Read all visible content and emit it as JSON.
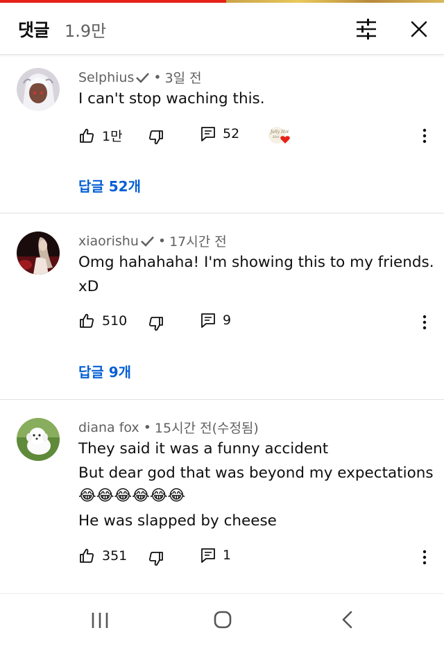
{
  "header": {
    "title": "댓글",
    "count": "1.9만",
    "filter_icon": "sliders-icon",
    "close_icon": "close-icon"
  },
  "comments": [
    {
      "author": "Selphius",
      "time": "3일 전",
      "lines": [
        "I can't stop waching this."
      ],
      "likes": "1만",
      "replies_count": "52",
      "creator_heart_text": "Jelly Hot",
      "replies_link": "답글 52개"
    },
    {
      "author": "xiaorishu",
      "time": "17시간 전",
      "lines": [
        "Omg hahahaha! I'm showing this to my friends.",
        "xD"
      ],
      "likes": "510",
      "replies_count": "9",
      "replies_link": "답글 9개"
    },
    {
      "author": "diana fox",
      "time": "15시간 전(수정됨)",
      "lines": [
        "They said it was a funny accident",
        "But dear god that was beyond my expectations",
        "😂😂😂😂😂😂",
        "He was slapped by cheese"
      ],
      "likes": "351",
      "replies_count": "1"
    }
  ],
  "colors": {
    "link": "#065fd4",
    "meta": "#606060",
    "text": "#0f0f0f",
    "heart": "#e62117"
  },
  "navbar": {
    "recents_icon": "recent-apps-icon",
    "home_icon": "home-icon",
    "back_icon": "back-icon"
  }
}
